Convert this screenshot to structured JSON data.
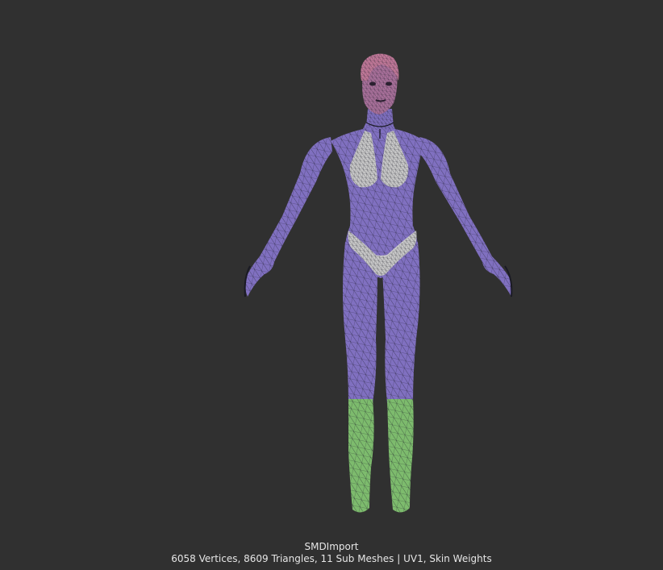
{
  "preview": {
    "asset_name": "SMDImport",
    "stats": "6058 Vertices, 8609 Triangles, 11 Sub Meshes | UV1, Skin Weights",
    "background_color": "#303030"
  },
  "model": {
    "submesh_colors": {
      "body": "#8070c0",
      "head": "#a8709a",
      "hair": "#c07898",
      "clothing": "#c8c8c8",
      "boots": "#7dbb6d",
      "wireframe": "#1c1c28"
    }
  }
}
